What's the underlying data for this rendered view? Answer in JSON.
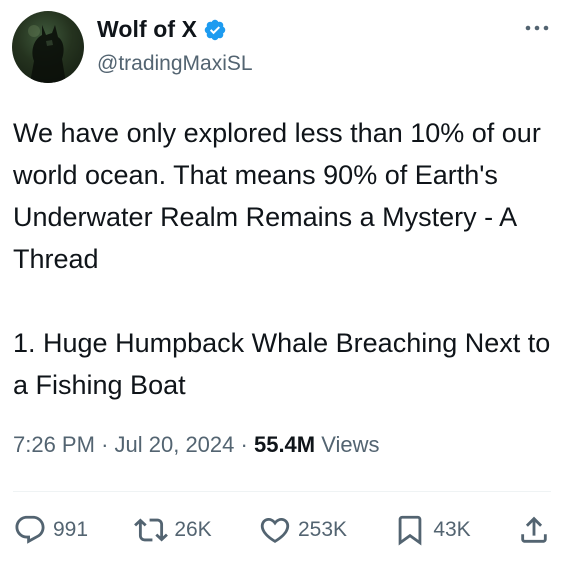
{
  "author": {
    "name": "Wolf of X",
    "handle": "@tradingMaxiSL",
    "verified": true,
    "badge_color": "#1d9bf0"
  },
  "tweet": {
    "text": "We have only explored less than 10% of our world ocean. That means 90% of Earth's Underwater Realm Remains a Mystery - A Thread\n\n1. Huge Humpback Whale Breaching Next to a Fishing Boat",
    "time": "7:26 PM",
    "separator": "·",
    "date": "Jul 20, 2024",
    "views_count": "55.4M",
    "views_label": "Views"
  },
  "actions": {
    "replies": "991",
    "reposts": "26K",
    "likes": "253K",
    "bookmarks": "43K"
  },
  "icons": {
    "more": "more-horizontal-icon",
    "reply": "reply-icon",
    "repost": "repost-icon",
    "like": "heart-icon",
    "bookmark": "bookmark-icon",
    "share": "share-icon"
  },
  "colors": {
    "text": "#0f1419",
    "secondary": "#536471",
    "divider": "#eff3f4"
  }
}
